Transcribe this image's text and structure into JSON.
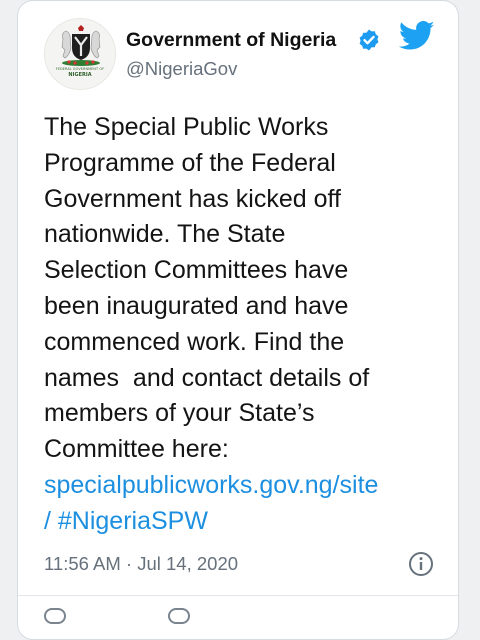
{
  "tweet": {
    "author": {
      "display_name": "Government of Nigeria",
      "handle": "@NigeriaGov",
      "verified": true,
      "avatar_seal_text": [
        "FEDERAL GOVERNMENT OF",
        "NIGERIA"
      ]
    },
    "body_lines": [
      "The Special Public Works",
      "Programme of the Federal",
      "Government has kicked off",
      "nationwide. The State",
      "Selection Committees have",
      "been inaugurated and have",
      "commenced work. Find the",
      "names  and contact details of",
      "members of your State’s",
      "Committee here:"
    ],
    "link_lines": [
      "specialpublicworks.gov.ng/site",
      "/ #NigeriaSPW"
    ],
    "timestamp": "11:56 AM · Jul 14, 2020"
  },
  "icons": {
    "verified": "verified-badge-icon",
    "twitter": "twitter-bird-icon",
    "info": "info-icon"
  },
  "colors": {
    "link": "#1d8fe0",
    "verified_badge": "#1d9bf0",
    "twitter_brand": "#1da1f2",
    "text": "#141414",
    "muted": "#66717c"
  }
}
